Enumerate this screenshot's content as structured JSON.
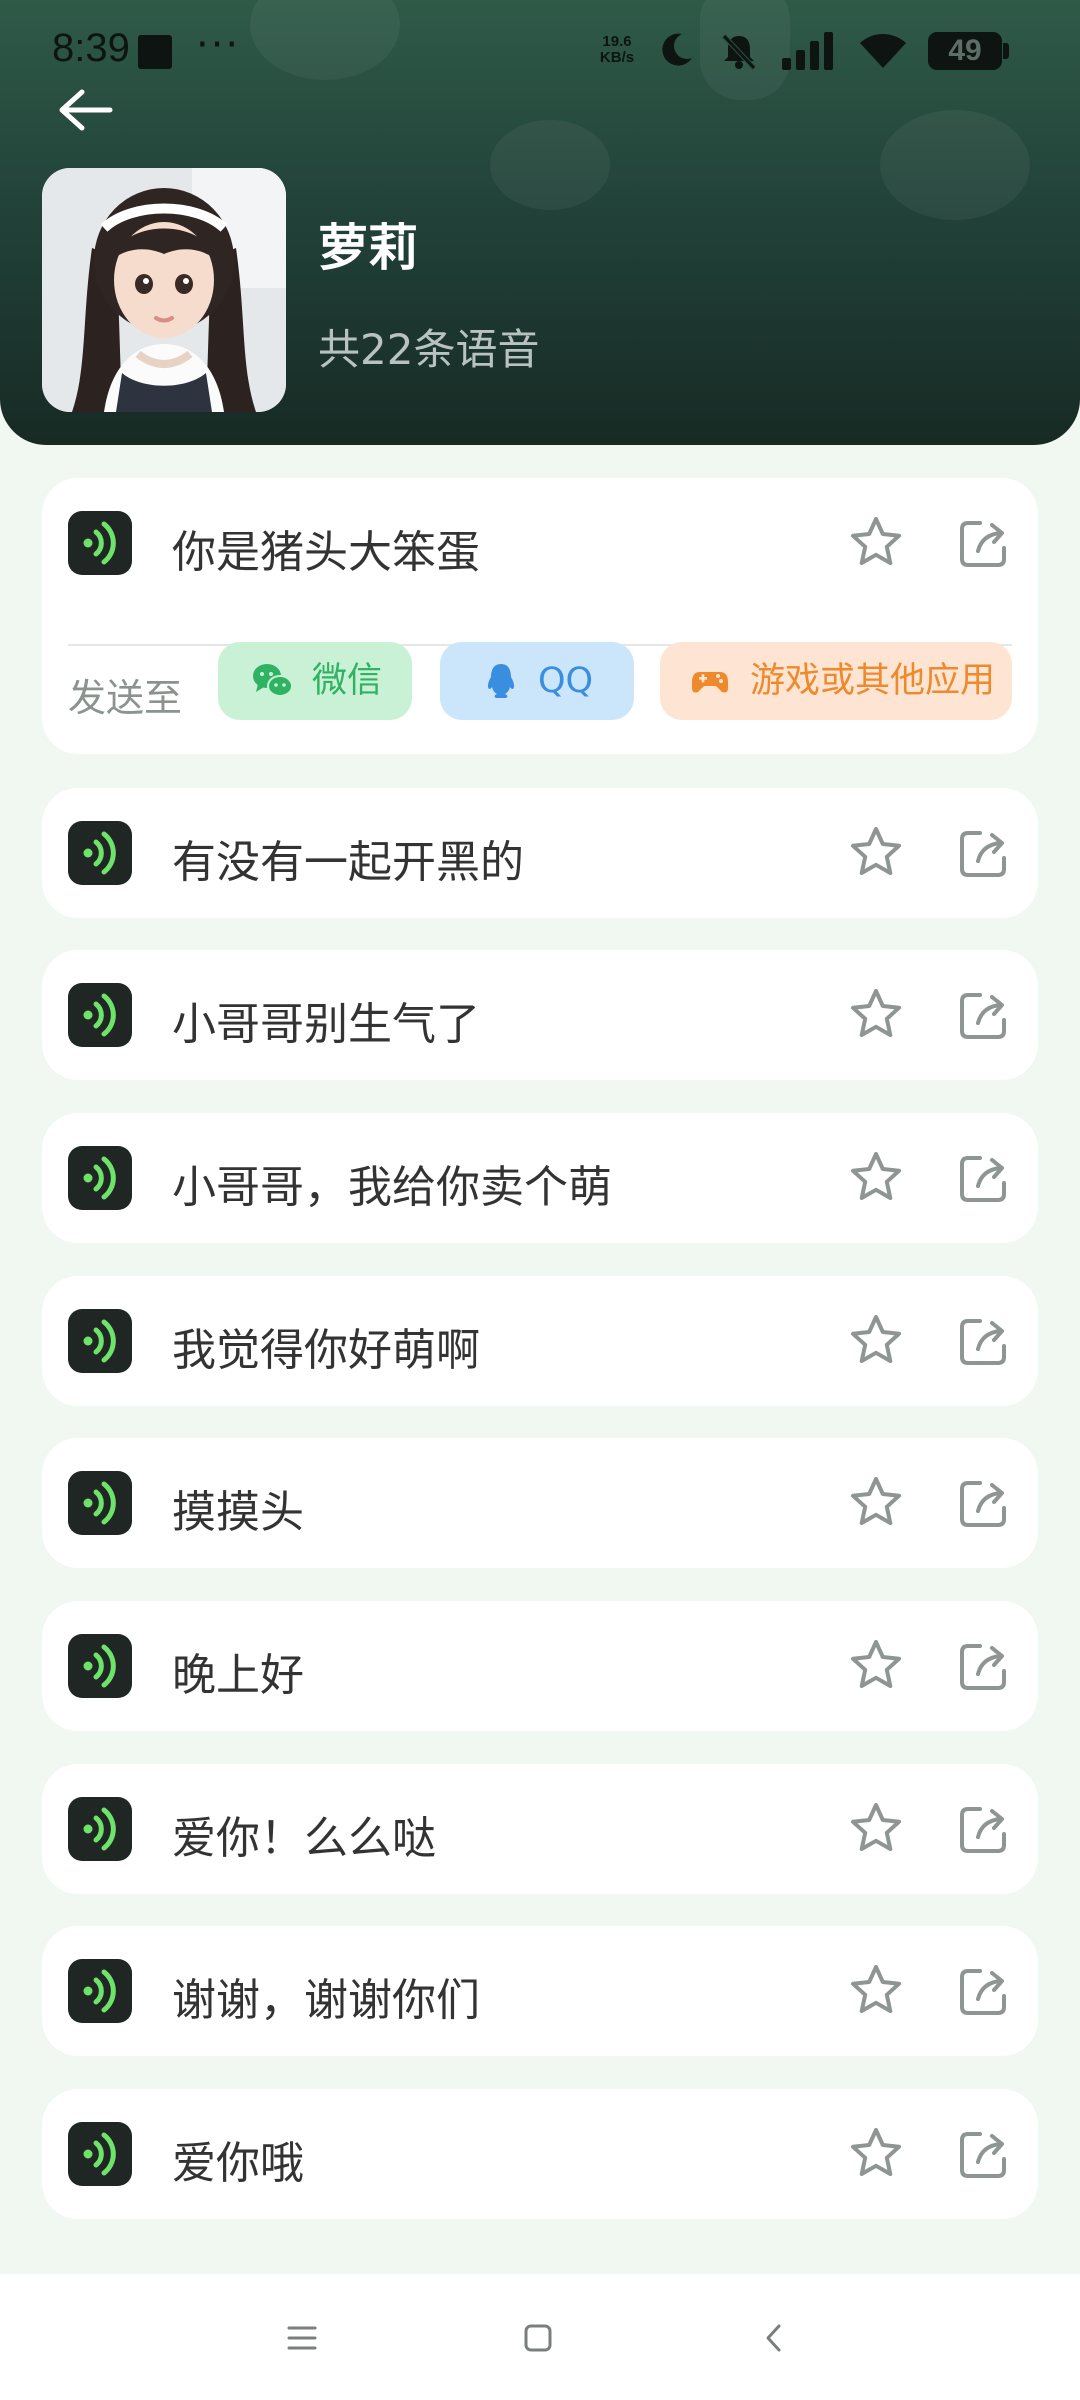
{
  "status": {
    "time": "8:39",
    "more": "···",
    "speed_value": "19.6",
    "speed_unit": "KB/s",
    "battery": "49",
    "icons": [
      "moon-icon",
      "bell-off-icon",
      "signal-icon",
      "wifi-icon",
      "battery-icon"
    ]
  },
  "header": {
    "name": "萝莉",
    "count": "共22条语音"
  },
  "send": {
    "label": "发送至",
    "wechat": "微信",
    "qq": "QQ",
    "game": "游戏或其他应用"
  },
  "voices": [
    {
      "title": "你是猪头大笨蛋"
    },
    {
      "title": "有没有一起开黑的"
    },
    {
      "title": "小哥哥别生气了"
    },
    {
      "title": "小哥哥，我给你卖个萌"
    },
    {
      "title": "我觉得你好萌啊"
    },
    {
      "title": "摸摸头"
    },
    {
      "title": "晚上好"
    },
    {
      "title": "爱你！么么哒"
    },
    {
      "title": "谢谢，谢谢你们"
    },
    {
      "title": "爱你哦"
    }
  ],
  "colors": {
    "accent_green": "#6ee36a",
    "header_dark": "#172a24",
    "wechat": "#2fb262",
    "qq": "#3a8ee0",
    "game": "#ef8a2c"
  }
}
